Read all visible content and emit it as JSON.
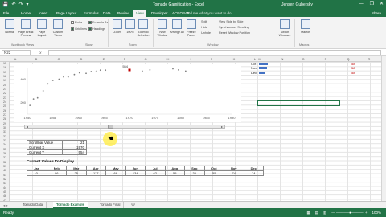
{
  "window": {
    "title": "Tornado Gamification - Excel",
    "user": "Jensen Gubersky",
    "quick_access": [
      "💾",
      "↶",
      "↷",
      "▾"
    ],
    "controls": [
      "—",
      "❐",
      "✕"
    ]
  },
  "ribbon_tabs": [
    "File",
    "Home",
    "Insert",
    "Page Layout",
    "Formulas",
    "Data",
    "Review",
    "View",
    "Developer",
    "ACROBAT"
  ],
  "active_tab": "View",
  "tell_me": "Tell me what you want to do",
  "share": "Share",
  "ribbon": {
    "views": [
      "Normal",
      "Page Break Preview",
      "Page Layout",
      "Custom Views"
    ],
    "views_group": "Workbook Views",
    "show": [
      {
        "label": "Ruler",
        "checked": false
      },
      {
        "label": "Formula Bar",
        "checked": true
      },
      {
        "label": "Gridlines",
        "checked": true
      },
      {
        "label": "Headings",
        "checked": true
      }
    ],
    "show_group": "Show",
    "zoom": [
      "Zoom",
      "100%",
      "Zoom to Selection"
    ],
    "zoom_group": "Zoom",
    "window_btns": [
      "New Window",
      "Arrange All",
      "Freeze Panes"
    ],
    "window_small": [
      "Split",
      "Hide",
      "Unhide",
      "View Side by Side",
      "Synchronous Scrolling",
      "Reset Window Position"
    ],
    "window_extra": "Switch Windows",
    "window_group": "Window",
    "macros": "Macros",
    "macros_group": "Macros"
  },
  "formula_bar": {
    "name_box": "N22",
    "fx": "fx",
    "formula": ""
  },
  "columns": [
    "A",
    "B",
    "C",
    "D",
    "E",
    "F",
    "G",
    "H",
    "I",
    "J",
    "K",
    "L",
    "M",
    "N",
    "O",
    "P",
    "Q",
    "R"
  ],
  "rows": [
    "15",
    "16",
    "17",
    "18",
    "19",
    "20",
    "21",
    "22",
    "23",
    "24",
    "25",
    "26",
    "27",
    "28",
    "29",
    "30",
    "31",
    "32",
    "33",
    "34",
    "35",
    "36",
    "37",
    "38",
    "39",
    "40",
    "41",
    "42",
    "43",
    "44",
    "45",
    "46",
    "47"
  ],
  "chart_data": {
    "type": "scatter",
    "title": "",
    "xlabel": "",
    "ylabel": "",
    "xlim": [
      1950,
      1990
    ],
    "ylim": [
      100,
      500
    ],
    "x_ticks": [
      "1950",
      "1955",
      "1960",
      "1965",
      "1970",
      "1975",
      "1980",
      "1985",
      "1990"
    ],
    "y_ticks": [
      "200",
      "400"
    ],
    "points": [
      [
        1950.5,
        175
      ],
      [
        1951.2,
        230
      ],
      [
        1952.0,
        240
      ],
      [
        1953.1,
        300
      ],
      [
        1954.0,
        360
      ],
      [
        1955.0,
        390
      ],
      [
        1956.2,
        400
      ],
      [
        1957.1,
        420
      ],
      [
        1958.0,
        420
      ],
      [
        1959.2,
        440
      ],
      [
        1960.2,
        455
      ],
      [
        1961.5,
        450
      ],
      [
        1962.5,
        465
      ],
      [
        1963.5,
        470
      ],
      [
        1964.3,
        478
      ],
      [
        1965.3,
        478
      ],
      [
        1972.5,
        470
      ],
      [
        1974.0,
        480
      ],
      [
        1978.5,
        490
      ],
      [
        1979.6,
        480
      ],
      [
        1981.0,
        470
      ]
    ],
    "highlight": {
      "x": 1970,
      "y": 554,
      "label": "554",
      "color": "#c00000"
    }
  },
  "scroll": {
    "left_arrow": "◂",
    "right_arrow": "▸",
    "position": 0.42
  },
  "info_table": [
    {
      "label": "Scrollbar Value",
      "value": "21"
    },
    {
      "label": "Current X",
      "value": "1970"
    },
    {
      "label": "Current Y",
      "value": "554"
    }
  ],
  "current_values": {
    "title": "Current Values To Display",
    "months": [
      "Jan",
      "Feb",
      "Mar",
      "Apr",
      "May",
      "Jun",
      "Jul",
      "Aug",
      "Sep",
      "Oct",
      "Nov",
      "Dec"
    ],
    "values": [
      "0",
      "16",
      "25",
      "117",
      "68",
      "134",
      "62",
      "55",
      "35",
      "55",
      "74",
      "74"
    ]
  },
  "legend": [
    {
      "label": "Oct",
      "fraction": 0.6
    },
    {
      "label": "Nov",
      "fraction": 0.55
    },
    {
      "label": "Dec",
      "fraction": 0.4
    }
  ],
  "right_values": [
    "58",
    "58",
    "58"
  ],
  "sheet_tabs": [
    "Tornado Data",
    "Tornado Example",
    "Tornado Final"
  ],
  "active_sheet": "Tornado Example",
  "status": {
    "left": "Ready",
    "right": [
      "▦",
      "▤",
      "▥",
      "— ─────●───── +",
      "100%"
    ]
  },
  "colors": {
    "excel_green": "#217346",
    "point_color": "#7f7f7f",
    "highlight": "#c00000",
    "bar": "#4472c4",
    "cursor": "#ffeb3b"
  }
}
